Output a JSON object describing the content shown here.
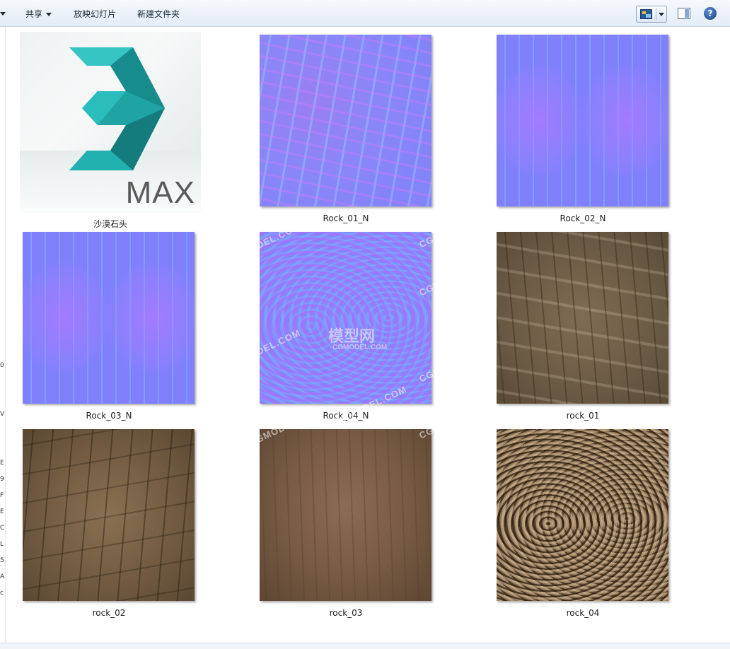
{
  "toolbar": {
    "share_label": "共享",
    "slideshow_label": "放映幻灯片",
    "new_folder_label": "新建文件夹",
    "help_symbol": "?"
  },
  "left_strip_chars": [
    "0",
    "V",
    "E",
    "9",
    "F",
    "E",
    "C",
    "L",
    "5",
    "A",
    "c"
  ],
  "files": [
    {
      "name": "沙漠石头",
      "icon": "3ds-max-icon",
      "logo_text": "MAX"
    },
    {
      "name": "Rock_01_N",
      "icon": "normal-map-thumbnail"
    },
    {
      "name": "Rock_02_N",
      "icon": "normal-map-thumbnail"
    },
    {
      "name": "Rock_03_N",
      "icon": "normal-map-thumbnail"
    },
    {
      "name": "Rock_04_N",
      "icon": "normal-map-thumbnail"
    },
    {
      "name": "rock_01",
      "icon": "rock-texture-thumbnail"
    },
    {
      "name": "rock_02",
      "icon": "rock-texture-thumbnail"
    },
    {
      "name": "rock_03",
      "icon": "rock-texture-thumbnail"
    },
    {
      "name": "rock_04",
      "icon": "rock-texture-thumbnail"
    }
  ],
  "watermarks": [
    "CGMODEL.COM",
    "CGMODEL.COM",
    "CGMODEL.COM",
    "CGMODEL.COM",
    "CGMODEL.COM",
    "CGMODEL.COM",
    "CGMODEL.COM",
    "CGMODEL.COM"
  ],
  "watermark_center": "模型网",
  "watermark_center_sub": "CGMODEL.COM",
  "colors": {
    "toolbar_bg": "#e4ecf6",
    "accent": "#17407f"
  }
}
